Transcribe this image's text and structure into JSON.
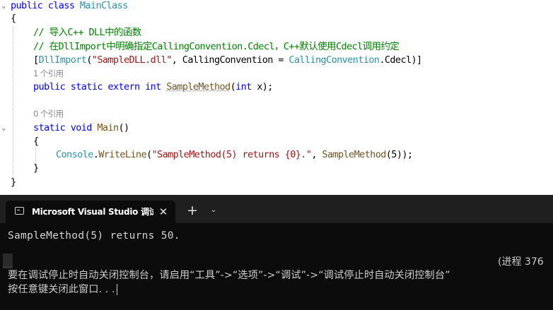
{
  "editor": {
    "line1": {
      "kw1": "public",
      "kw2": "class",
      "cls": "MainClass"
    },
    "brace_open": "{",
    "comment1": "// 导入C++ DLL中的函数",
    "comment2": "// 在DllImport中明确指定CallingConvention.Cdecl，C++默认使用Cdecl调用约定",
    "attr": {
      "open": "[",
      "name": "DllImport",
      "paren_open": "(",
      "dll": "\"SampleDLL.dll\"",
      "mid": ", CallingConvention = ",
      "enum_type": "CallingConvention",
      "enum_val": ".Cdecl",
      "close": ")]"
    },
    "ref1": "1 个引用",
    "decl": {
      "kw1": "public",
      "kw2": "static",
      "kw3": "extern",
      "kw4": "int",
      "name": "SampleMethod",
      "p_open": "(",
      "p_kw": "int",
      "p_rest": " x);"
    },
    "ref0": "0 个引用",
    "main_decl": {
      "kw1": "static",
      "kw2": "void",
      "name": "Main",
      "parens": "()"
    },
    "inner_open": "{",
    "call": {
      "cls": "Console",
      "dot": ".",
      "meth": "WriteLine",
      "p_open": "(",
      "str": "\"SampleMethod(5) returns {0}.\"",
      "comma": ", ",
      "meth2": "SampleMethod",
      "args": "(5));"
    },
    "inner_close": "}",
    "brace_close": "}"
  },
  "terminal": {
    "tab_title": "Microsoft Visual Studio 调试控",
    "close_glyph": "✕",
    "new_tab_glyph": "+",
    "dropdown_glyph": "⌄",
    "output": "SampleMethod(5) returns 50.",
    "process_text": "(进程 376",
    "hint_line": "要在调试停止时自动关闭控制台，请启用“工具”->“选项”->“调试”->“调试停止时自动关闭控制台”",
    "press_key": "按任意键关闭此窗口. . ."
  },
  "icons": {
    "fold_glyph": "⌄"
  }
}
